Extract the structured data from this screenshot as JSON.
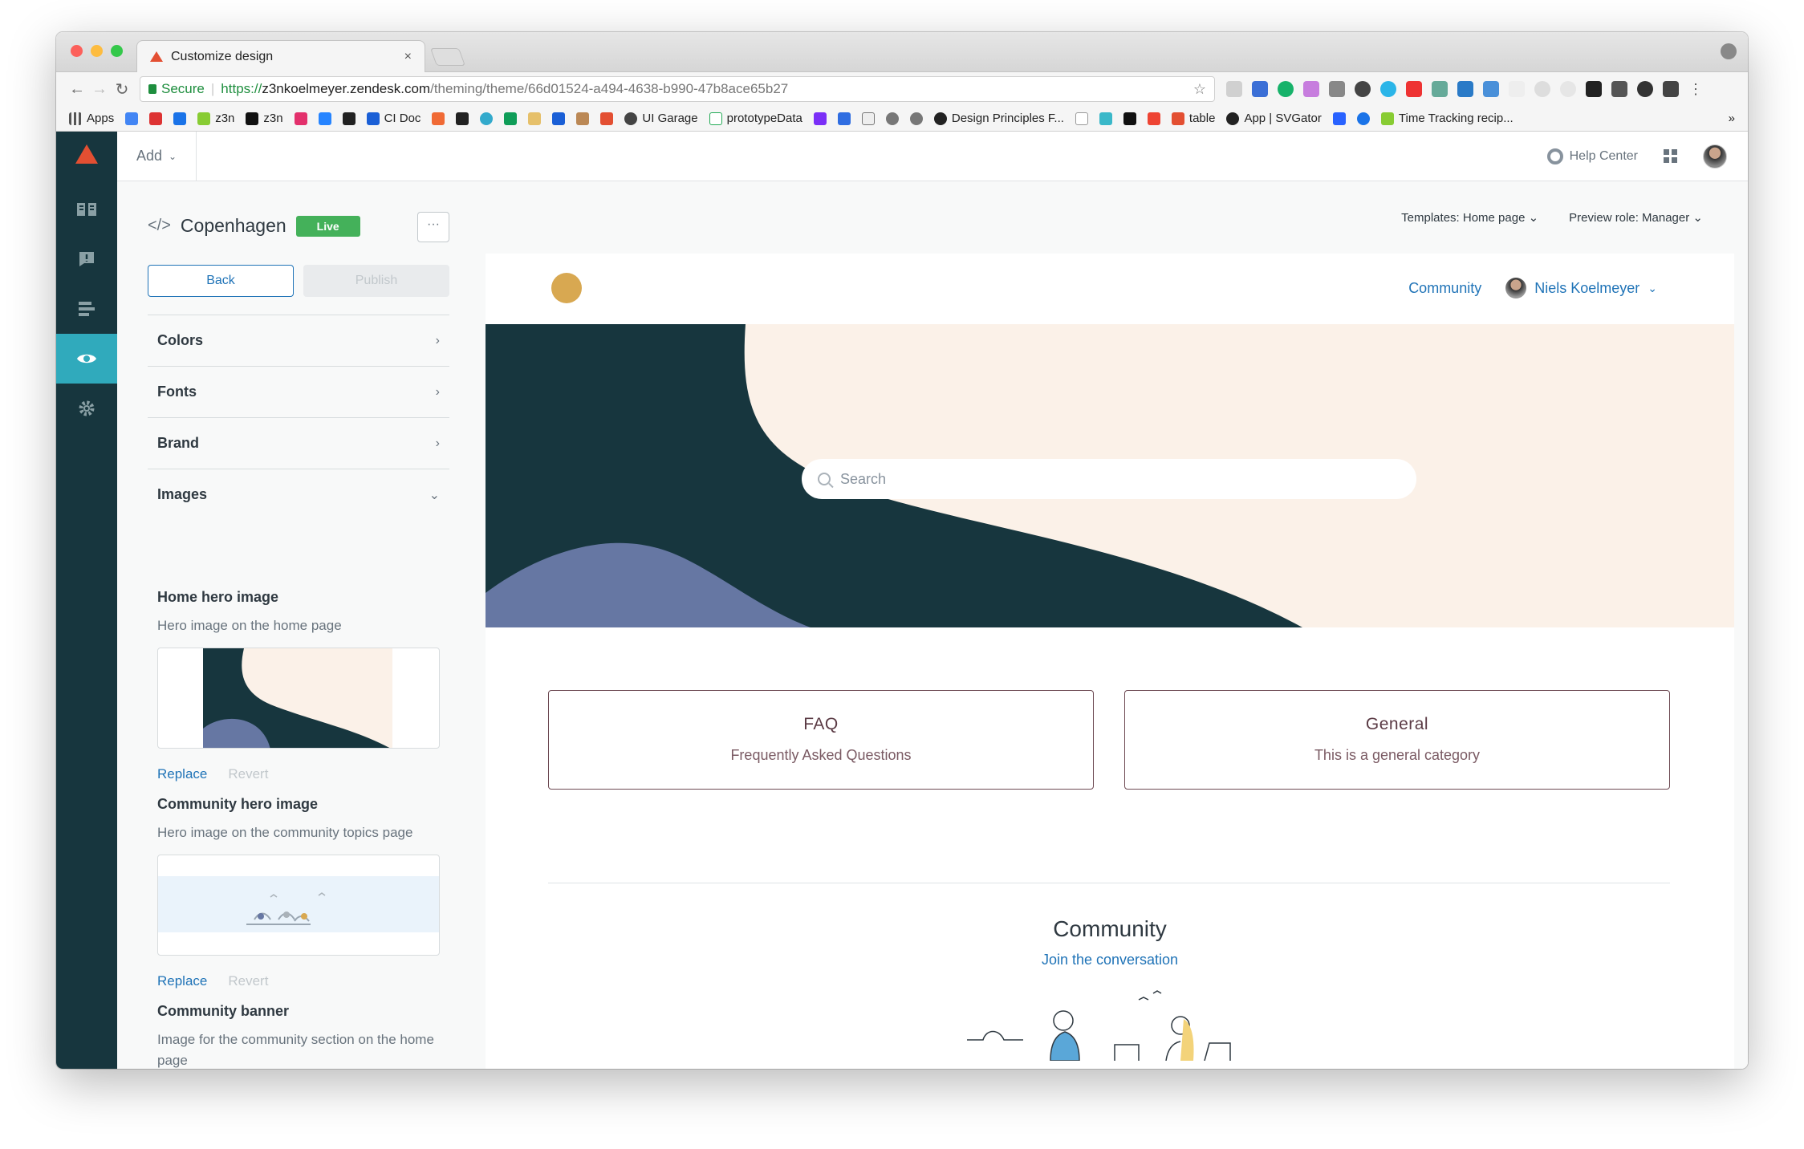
{
  "browser": {
    "tab_title": "Customize design",
    "tab_close": "×",
    "secure_label": "Secure",
    "url_scheme": "https://",
    "url_host": "z3nkoelmeyer.zendesk.com",
    "url_path": "/theming/theme/66d01524-a494-4638-b990-47b8ace65b27",
    "bookmarks": [
      "Apps",
      "z3n",
      "z3n",
      "CI Doc",
      "UI Garage",
      "prototypeData",
      "Design Principles F...",
      "table",
      "App | SVGator",
      "Time Tracking recip..."
    ],
    "bookmarks_more": "»"
  },
  "topbar": {
    "add_label": "Add",
    "help_center": "Help Center"
  },
  "panel": {
    "theme_name": "Copenhagen",
    "status_badge": "Live",
    "more_label": "···",
    "back_label": "Back",
    "publish_label": "Publish",
    "accordion": [
      {
        "label": "Colors",
        "chevron": "›"
      },
      {
        "label": "Fonts",
        "chevron": "›"
      },
      {
        "label": "Brand",
        "chevron": "›"
      },
      {
        "label": "Images",
        "chevron": "⌄"
      }
    ],
    "images": [
      {
        "title": "Home hero image",
        "desc": "Hero image on the home page",
        "replace": "Replace",
        "revert": "Revert"
      },
      {
        "title": "Community hero image",
        "desc": "Hero image on the community topics page",
        "replace": "Replace",
        "revert": "Revert"
      },
      {
        "title": "Community banner",
        "desc": "Image for the community section on the home page"
      }
    ]
  },
  "preview_head": {
    "templates": "Templates: Home page",
    "preview_role": "Preview role: Manager"
  },
  "site": {
    "nav_community": "Community",
    "user_name": "Niels Koelmeyer",
    "search_placeholder": "Search",
    "categories": [
      {
        "title": "FAQ",
        "desc": "Frequently Asked Questions"
      },
      {
        "title": "General",
        "desc": "This is a general category"
      }
    ],
    "community_title": "Community",
    "community_link": "Join the conversation"
  },
  "colors": {
    "rail": "#17363e",
    "rail_active": "#30aabc",
    "hero_dark": "#17363e",
    "hero_cream": "#fbf1e8",
    "hero_blue": "#6677a3",
    "logo_gold": "#d8a851",
    "live_green": "#44b15a"
  }
}
